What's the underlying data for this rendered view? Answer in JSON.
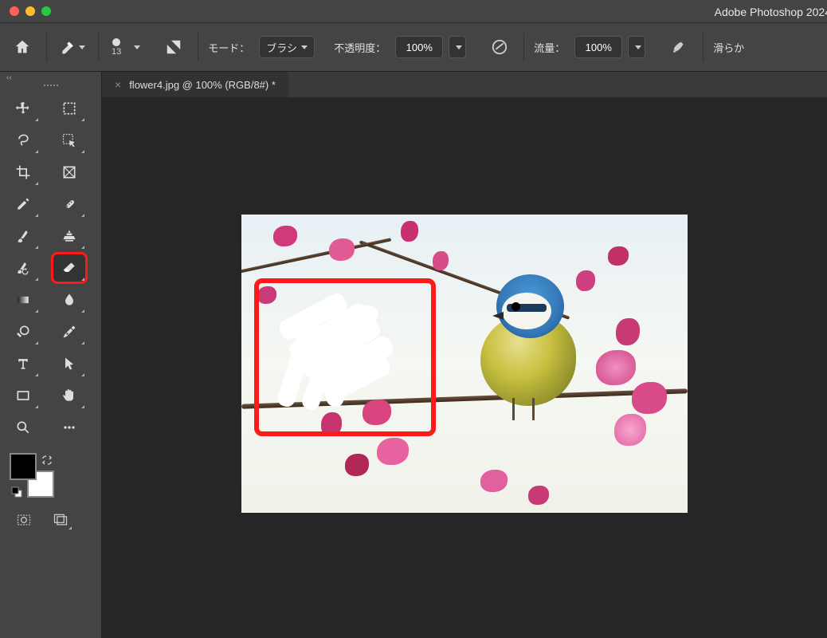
{
  "titlebar": {
    "app_title": "Adobe Photoshop 2024"
  },
  "options": {
    "brush_size": "13",
    "mode_label": "モード：",
    "mode_value": "ブラシ",
    "opacity_label": "不透明度：",
    "opacity_value": "100%",
    "flow_label": "流量：",
    "flow_value": "100%",
    "smoothing_label": "滑らか"
  },
  "document": {
    "tab_title": "flower4.jpg @ 100% (RGB/8#) *",
    "close": "×"
  },
  "tools": {
    "move": "move-tool",
    "marquee": "marquee-tool",
    "lasso": "lasso-tool",
    "object_select": "object-selection-tool",
    "crop": "crop-tool",
    "frame": "frame-tool",
    "eyedropper": "eyedropper-tool",
    "heal": "spot-heal-tool",
    "brush": "brush-tool",
    "stamp": "clone-stamp-tool",
    "history_brush": "history-brush-tool",
    "eraser": "eraser-tool",
    "gradient": "gradient-tool",
    "blur": "blur-tool",
    "dodge": "dodge-tool",
    "pen": "pen-tool",
    "type": "type-tool",
    "path": "path-selection-tool",
    "rectangle": "rectangle-tool",
    "hand": "hand-tool",
    "zoom": "zoom-tool",
    "more": "edit-toolbar"
  },
  "colors": {
    "foreground": "#000000",
    "background": "#ffffff"
  }
}
